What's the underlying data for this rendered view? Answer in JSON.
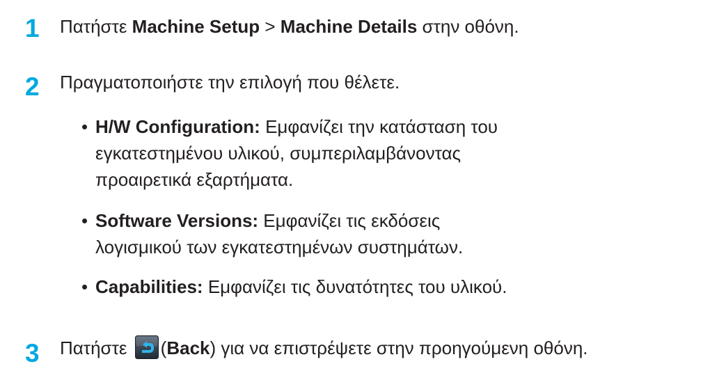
{
  "colors": {
    "step_number": "#00a9e0",
    "text": "#231f20"
  },
  "steps": [
    {
      "number": "1",
      "prefix": "Πατήστε ",
      "bold1": "Machine Setup",
      "sep": " > ",
      "bold2": "Machine Details",
      "suffix": " στην οθόνη."
    },
    {
      "number": "2",
      "text": "Πραγματοποιήστε την επιλογή που θέλετε.",
      "bullets": [
        {
          "marker": "•",
          "term": "H/W Configuration:",
          "desc": " Εμφανίζει την κατάσταση του εγκατεστημένου υλικού, συμπεριλαμβάνοντας προαιρετικά εξαρτήματα."
        },
        {
          "marker": "•",
          "term": "Software Versions:",
          "desc": " Εμφανίζει τις εκδόσεις λογισμικού των εγκατεστημένων συστημάτων."
        },
        {
          "marker": "•",
          "term": "Capabilities:",
          "desc": " Εμφανίζει τις δυνατότητες του υλικού."
        }
      ]
    },
    {
      "number": "3",
      "prefix": "Πατήστε ",
      "icon": "back-arrow-icon",
      "paren_open": "(",
      "bold1": "Back",
      "suffix": ") για να επιστρέψετε στην προηγούμενη οθόνη."
    }
  ]
}
